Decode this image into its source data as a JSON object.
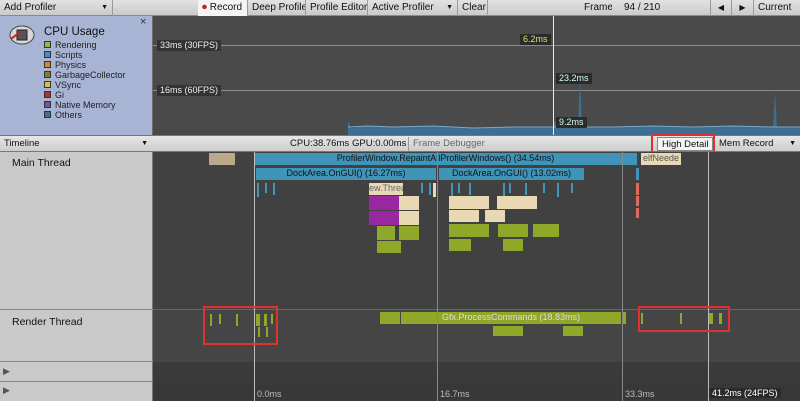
{
  "toolbar": {
    "add_profiler": "Add Profiler",
    "record": "Record",
    "deep_profile": "Deep Profile",
    "profile_editor": "Profile Editor",
    "active_profiler": "Active Profiler",
    "clear": "Clear",
    "frame_label": "Frame:",
    "frame_value": "94 / 210",
    "current": "Current"
  },
  "legend": {
    "title": "CPU Usage",
    "close": "×",
    "items": [
      {
        "label": "Rendering",
        "color": "#8fb84a"
      },
      {
        "label": "Scripts",
        "color": "#4a8cc4"
      },
      {
        "label": "Physics",
        "color": "#d08a30"
      },
      {
        "label": "GarbageCollector",
        "color": "#8a7a30"
      },
      {
        "label": "VSync",
        "color": "#d8c040"
      },
      {
        "label": "Gi",
        "color": "#b03030"
      },
      {
        "label": "Native Memory",
        "color": "#7a50a0"
      },
      {
        "label": "Others",
        "color": "#40708c"
      }
    ]
  },
  "chart": {
    "fps30": "33ms (30FPS)",
    "fps60": "16ms (60FPS)",
    "val1": "6.2ms",
    "val2": "23.2ms",
    "val3": "9.2ms"
  },
  "timeline_header": {
    "dropdown": "Timeline",
    "cpu": "CPU:38.76ms",
    "gpu": "GPU:0.00ms",
    "frame_debugger": "Frame Debugger",
    "high_detail": "High Detail",
    "mem_record": "Mem Record"
  },
  "threads": {
    "main": "Main Thread",
    "render": "Render Thread"
  },
  "bars": {
    "repaint": "ProfilerWindow.RepaintAllProfilerWindows() (34.54ms)",
    "dock1": "DockArea.OnGUI() (16.27ms)",
    "dock2": "DockArea.OnGUI() (13.02ms)",
    "view_thread": "ew.Threa",
    "self_needed": "elfNeede",
    "gfx": "Gfx.ProcessCommands (18.83ms)"
  },
  "axis": {
    "t0": "0.0ms",
    "t1": "16.7ms",
    "t2": "33.3ms",
    "t3": "41.2ms (24FPS)"
  }
}
